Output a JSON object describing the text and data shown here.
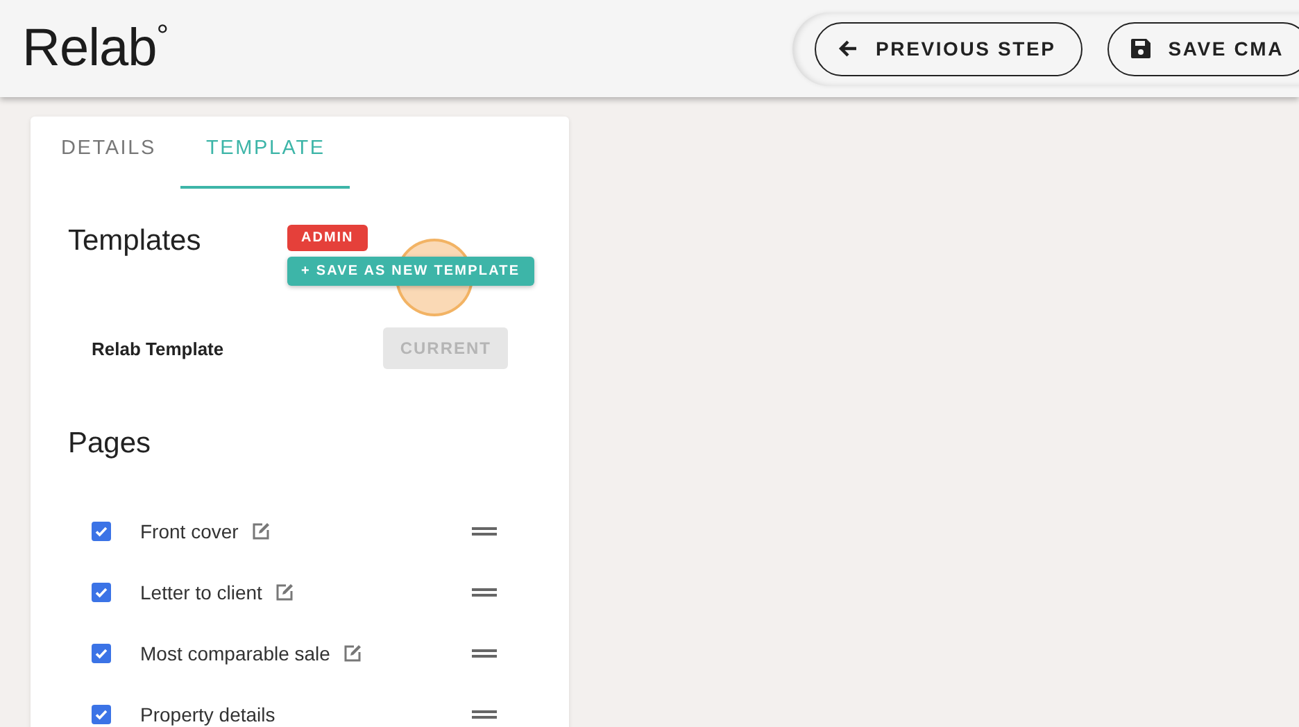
{
  "header": {
    "logo": "Relab",
    "logo_mark": "°",
    "buttons": [
      {
        "label": "PREVIOUS STEP",
        "kind": "back"
      },
      {
        "label": "SAVE CMA",
        "kind": "save"
      }
    ]
  },
  "tabs": [
    {
      "label": "DETAILS",
      "selected": false
    },
    {
      "label": "TEMPLATE",
      "selected": true
    }
  ],
  "templates": {
    "heading": "Templates",
    "badge": "ADMIN",
    "save_button": "+ SAVE AS NEW TEMPLATE",
    "items": [
      {
        "name": "Relab Template",
        "status": "CURRENT",
        "disabled": true
      }
    ]
  },
  "pages": {
    "heading": "Pages",
    "items": [
      {
        "label": "Front cover",
        "checked": true,
        "editable": true
      },
      {
        "label": "Letter to client",
        "checked": true,
        "editable": true
      },
      {
        "label": "Most comparable sale",
        "checked": true,
        "editable": true
      },
      {
        "label": "Property details",
        "checked": true,
        "editable": false
      }
    ]
  }
}
